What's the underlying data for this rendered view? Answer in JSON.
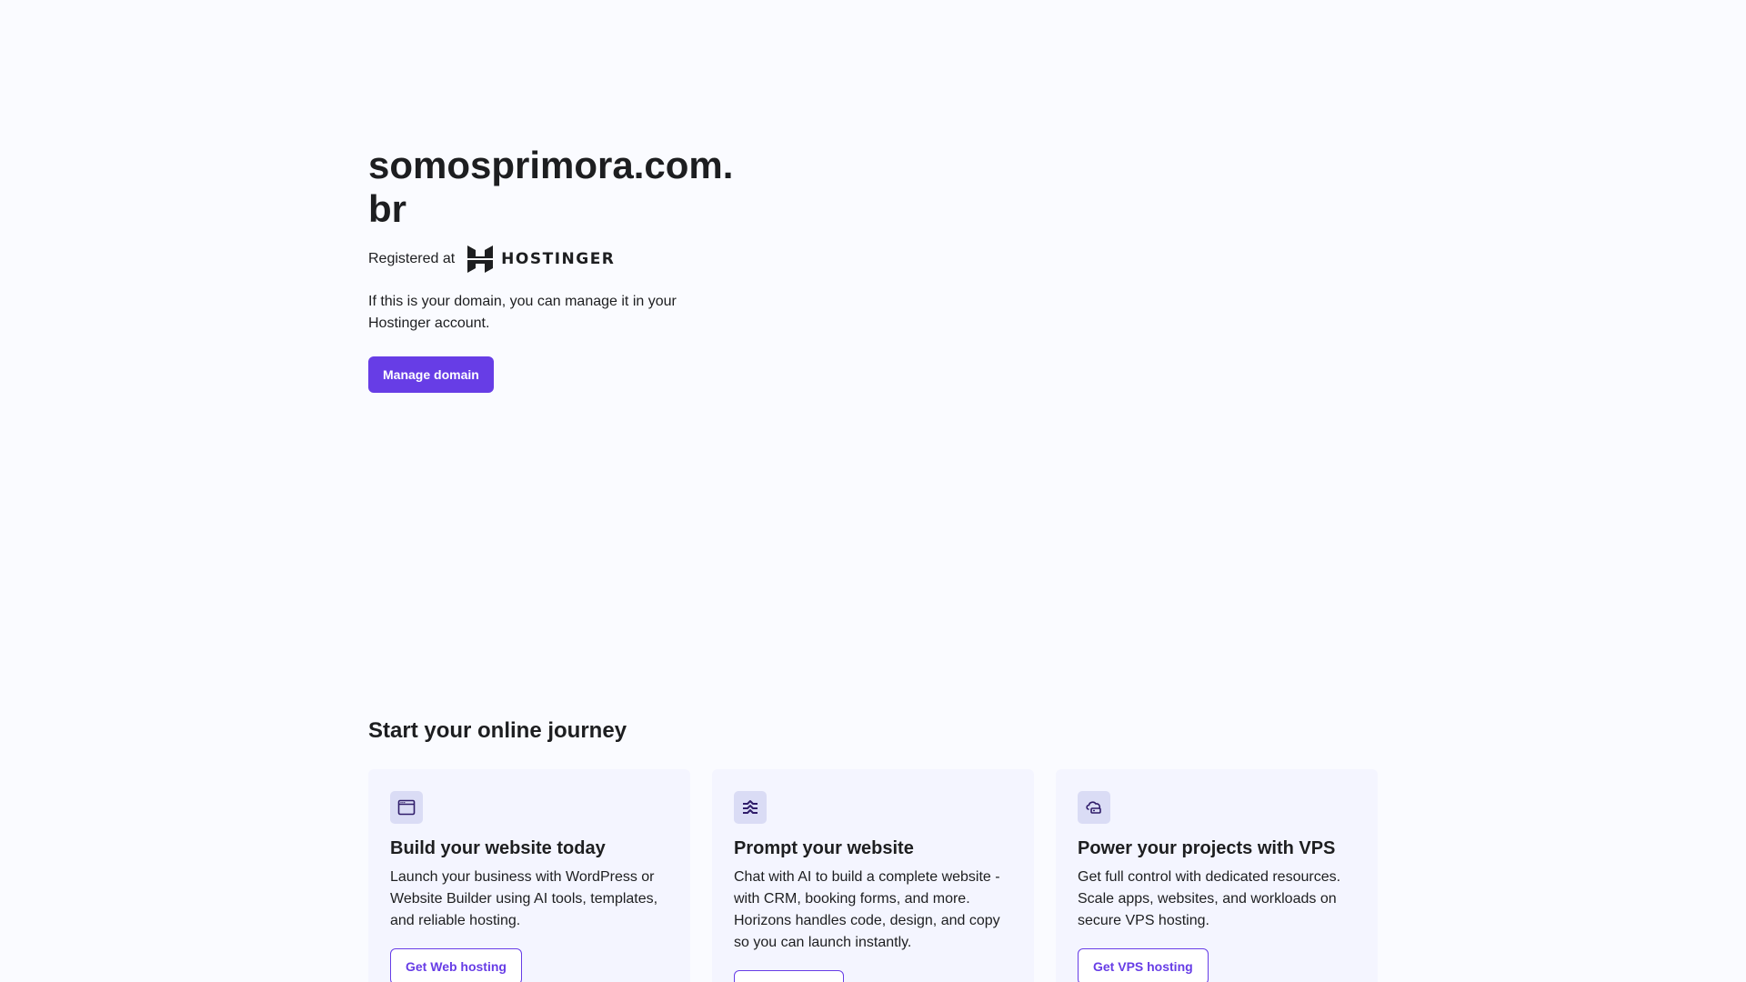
{
  "hero": {
    "domain": "somosprimora.com.br",
    "registered_label": "Registered at",
    "brand_name": "HOSTINGER",
    "description": "If this is your domain, you can manage it in your Hostinger account.",
    "manage_button": "Manage domain"
  },
  "journey": {
    "title": "Start your online journey",
    "cards": [
      {
        "icon": "browser-window-icon",
        "title": "Build your website today",
        "description": "Launch your business with WordPress or Website Builder using AI tools, templates, and reliable hosting.",
        "button": "Get Web hosting"
      },
      {
        "icon": "horizons-icon",
        "title": "Prompt your website",
        "description": "Chat with AI to build a complete website - with CRM, booking forms, and more. Horizons handles code, design, and copy so you can launch instantly.",
        "button": ""
      },
      {
        "icon": "cloud-server-icon",
        "title": "Power your projects with VPS",
        "description": "Get full control with dedicated resources. Scale apps, websites, and workloads on secure VPS hosting.",
        "button": "Get VPS hosting"
      }
    ]
  },
  "colors": {
    "accent": "#673de6",
    "background": "#fafbff",
    "card_background": "#f4f5ff",
    "icon_background": "#dadcf5",
    "text": "#1d1e20"
  }
}
